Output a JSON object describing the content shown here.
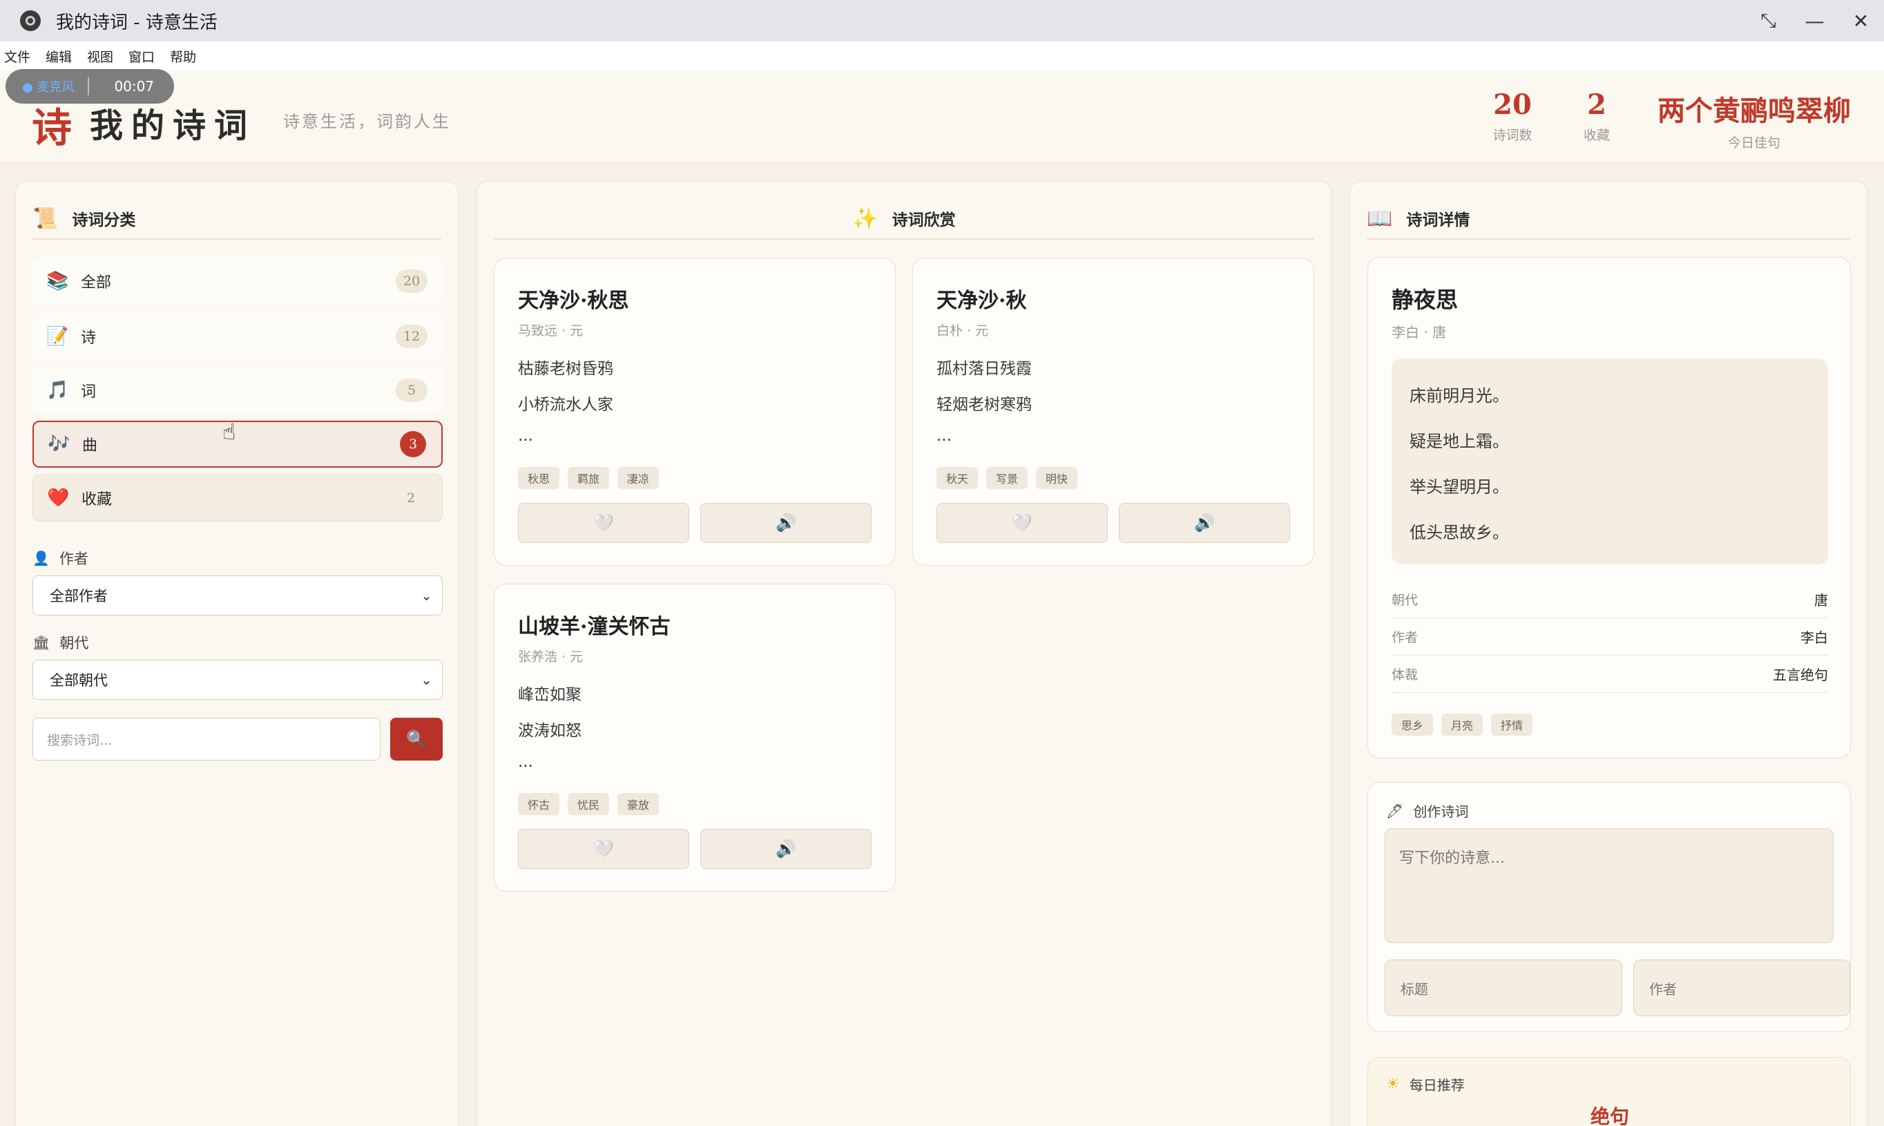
{
  "window": {
    "title": "我的诗词 - 诗意生活",
    "controls": [
      "⤡",
      "—",
      "✕"
    ]
  },
  "menu": [
    "文件",
    "编辑",
    "视图",
    "窗口",
    "帮助"
  ],
  "recording": {
    "mic_label": "● 麦克风",
    "time": "00:07"
  },
  "header": {
    "logo_char": "诗",
    "app_name": "我的诗词",
    "slogan": "诗意生活，词韵人生",
    "stats": [
      {
        "value": "20",
        "label": "诗词数"
      },
      {
        "value": "2",
        "label": "收藏"
      },
      {
        "value": "两个黄鹂鸣翠柳",
        "label": "今日佳句"
      }
    ]
  },
  "sidebar": {
    "title": "诗词分类",
    "categories": [
      {
        "label": "全部",
        "count": "20",
        "icon": "📚"
      },
      {
        "label": "诗",
        "count": "12",
        "icon": "📝"
      },
      {
        "label": "词",
        "count": "5",
        "icon": "🎵"
      },
      {
        "label": "曲",
        "count": "3",
        "icon": "🎶"
      },
      {
        "label": "收藏",
        "count": "2",
        "icon": "❤️"
      }
    ],
    "author_label": "作者",
    "author_value": "全部作者",
    "dynasty_label": "朝代",
    "dynasty_value": "全部朝代",
    "search_placeholder": "搜索诗词...",
    "search_icon": "🔍"
  },
  "gallery": {
    "title": "诗词欣赏",
    "cards": [
      {
        "title": "天净沙·秋思",
        "meta": "马致远 · 元",
        "lines": [
          "枯藤老树昏鸦",
          "小桥流水人家",
          "..."
        ],
        "tags": [
          "秋思",
          "羁旅",
          "凄凉"
        ]
      },
      {
        "title": "天净沙·秋",
        "meta": "白朴 · 元",
        "lines": [
          "孤村落日残霞",
          "轻烟老树寒鸦",
          "..."
        ],
        "tags": [
          "秋天",
          "写景",
          "明快"
        ]
      },
      {
        "title": "山坡羊·潼关怀古",
        "meta": "张养浩 · 元",
        "lines": [
          "峰峦如聚",
          "波涛如怒",
          "..."
        ],
        "tags": [
          "怀古",
          "忧民",
          "豪放"
        ]
      }
    ],
    "fav_icon": "🤍",
    "audio_icon": "🔊"
  },
  "detail": {
    "title": "诗词详情",
    "poem_title": "静夜思",
    "poem_meta": "李白 · 唐",
    "lines": [
      "床前明月光。",
      "疑是地上霜。",
      "举头望明月。",
      "低头思故乡。"
    ],
    "rows": [
      {
        "key": "朝代",
        "value": "唐"
      },
      {
        "key": "作者",
        "value": "李白"
      },
      {
        "key": "体裁",
        "value": "五言绝句"
      }
    ],
    "tags": [
      "思乡",
      "月亮",
      "抒情"
    ]
  },
  "create": {
    "title": "创作诗词",
    "content_placeholder": "写下你的诗意...",
    "title_placeholder": "标题",
    "author_placeholder": "作者"
  },
  "daily": {
    "title": "每日推荐",
    "poem": "绝句"
  },
  "colors": {
    "accent": "#c0392b",
    "background": "#f6f1e7"
  }
}
